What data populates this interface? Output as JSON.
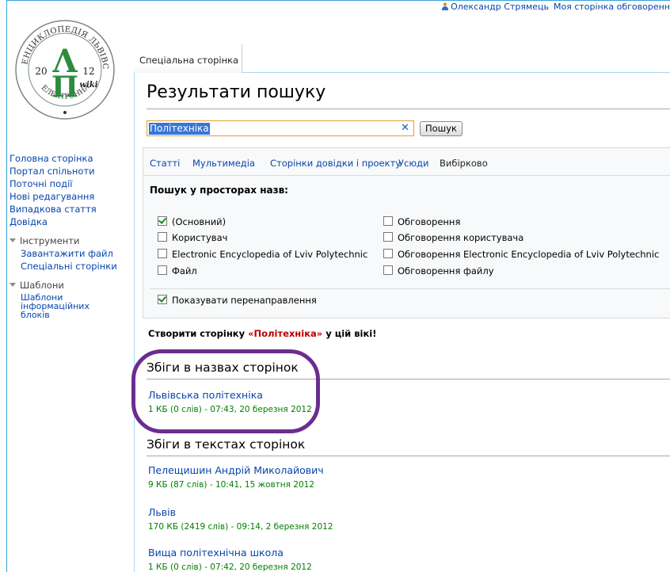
{
  "personal": {
    "username": "Олександр Стрямець",
    "my_talk": "Моя сторінка обговоренн"
  },
  "logo": {
    "arc_text": "ЕНЦИКЛОПЕДІЯ ЛЬВІВСЬКОЇ ПОЛІТЕХНІКИ",
    "bottom_text": "ЕЛЕКТРОННА",
    "year_left": "20",
    "year_right": "12",
    "wiki": "wiki"
  },
  "sidebar": {
    "nav": [
      "Головна сторінка",
      "Портал спільноти",
      "Поточні події",
      "Нові редагування",
      "Випадкова стаття",
      "Довідка"
    ],
    "tools_label": "Інструменти",
    "tools": [
      "Завантажити файл",
      "Спеціальні сторінки"
    ],
    "templates_label": "Шаблони",
    "templates_item": "Шаблони інформаційних блоків"
  },
  "tab": {
    "label": "Спеціальна сторінка"
  },
  "page": {
    "title": "Результати пошуку"
  },
  "search": {
    "value": "Політехніка",
    "button": "Пошук"
  },
  "profiles": {
    "items": [
      "Статті",
      "Мультимедіа",
      "Сторінки довідки і проекту",
      "Усюди"
    ],
    "active": "Вибірково"
  },
  "namespaces": {
    "title": "Пошук у просторах назв:",
    "left": [
      {
        "label": "(Основний)",
        "checked": true
      },
      {
        "label": "Користувач",
        "checked": false
      },
      {
        "label": "Electronic Encyclopedia of Lviv Polytechnic",
        "checked": false
      },
      {
        "label": "Файл",
        "checked": false
      }
    ],
    "right": [
      {
        "label": "Обговорення",
        "checked": false
      },
      {
        "label": "Обговорення користувача",
        "checked": false
      },
      {
        "label": "Обговорення Electronic Encyclopedia of Lviv Polytechnic",
        "checked": false
      },
      {
        "label": "Обговорення файлу",
        "checked": false
      }
    ],
    "redirects": {
      "label": "Показувати перенаправлення",
      "checked": true
    }
  },
  "create": {
    "prefix": "Створити сторінку ",
    "page": "«Політехніка»",
    "suffix": " у цій вікі!"
  },
  "title_matches": {
    "heading": "Збіги в назвах сторінок",
    "results": [
      {
        "title": "Львівська політехніка",
        "meta": "1 КБ (0 слів) - 07:43, 20 березня 2012"
      }
    ]
  },
  "text_matches": {
    "heading": "Збіги в текстах сторінок",
    "results": [
      {
        "title": "Пелещишин Андрій Миколайович",
        "meta": "9 КБ (87 слів) - 10:41, 15 жовтня 2012"
      },
      {
        "title": "Львів",
        "meta": "170 КБ (2419 слів) - 09:14, 2 березня 2012"
      },
      {
        "title": "Вища політехнічна школа",
        "meta": "1 КБ (0 слів) - 07:42, 20 березня 2012"
      }
    ]
  },
  "colors": {
    "link": "#0645ad",
    "meta": "#008000",
    "highlight": "#6a2d8f",
    "logo": "#2e8b3e"
  }
}
